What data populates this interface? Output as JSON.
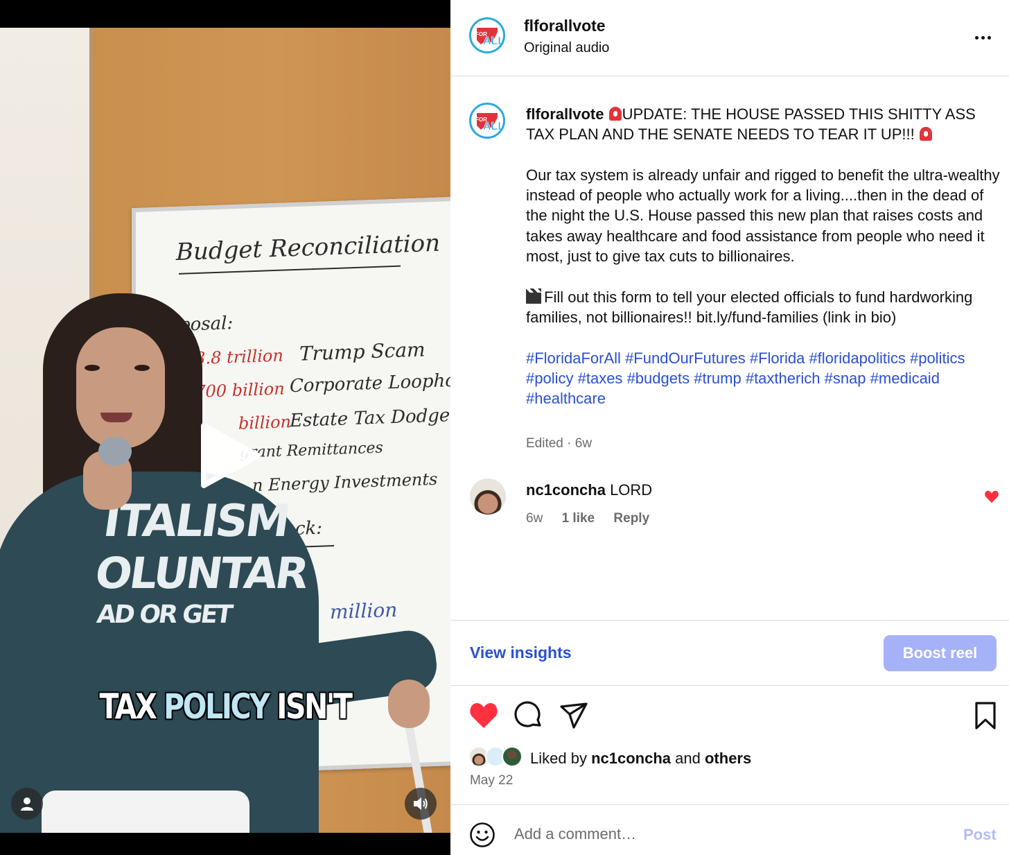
{
  "video": {
    "caption_words": [
      "TAX",
      "POLICY",
      "ISN'T"
    ],
    "whiteboard": {
      "title": "Budget Reconciliation",
      "proposal_label": "posal:",
      "items": [
        {
          "amount": "$3.8 trillion",
          "label": "Trump Scam"
        },
        {
          "amount": "$700 billion",
          "label": "Corporate Loophole"
        },
        {
          "amount": "billion",
          "label": "Estate Tax Dodge"
        },
        {
          "amount": "",
          "label": "grant Remittances"
        },
        {
          "amount": "",
          "label": "n Energy Investments"
        }
      ],
      "block_label": "lock:",
      "bottom_amount": "million"
    },
    "sweater_print": [
      "ITALISM",
      "OLUNTAR",
      "AD OR GET"
    ],
    "icons": {
      "play": "play-icon",
      "user": "user-icon",
      "volume": "volume-icon"
    }
  },
  "header": {
    "username": "flforallvote",
    "audio": "Original audio",
    "logo_text_top": "FOR",
    "logo_text_main": "ALL"
  },
  "caption": {
    "username": "flforallvote",
    "headline": "UPDATE: THE HOUSE PASSED THIS SHITTY ASS TAX PLAN AND THE SENATE NEEDS TO TEAR IT UP!!!",
    "paragraph_1": "Our tax system is already unfair and rigged to benefit the ultra-wealthy instead of people who actually work for a living....then in the dead of the night the U.S. House passed this new plan that raises costs and takes away healthcare and food assistance from people who need it most, just to give tax cuts to billionaires.",
    "paragraph_2": "Fill out this form to tell your elected officials to fund hardworking families, not billionaires!! bit.ly/fund-families (link in bio)",
    "hashtags": [
      "#FloridaForAll",
      "#FundOurFutures",
      "#Florida",
      "#floridapolitics",
      "#politics",
      "#policy",
      "#taxes",
      "#budgets",
      "#trump",
      "#taxtherich",
      "#snap",
      "#medicaid",
      "#healthcare"
    ],
    "edited_meta": "Edited · 6w"
  },
  "comment": {
    "username": "nc1concha",
    "text": "LORD",
    "age": "6w",
    "likes": "1 like",
    "reply": "Reply"
  },
  "insights": {
    "view_label": "View insights",
    "boost_label": "Boost reel"
  },
  "likes": {
    "prefix": "Liked by",
    "first_user": "nc1concha",
    "joiner": "and",
    "others": "others",
    "date": "May 22"
  },
  "comment_bar": {
    "placeholder": "Add a comment…",
    "post_label": "Post"
  },
  "colors": {
    "link_blue": "#2a4fd1",
    "boost_bg": "#a6b2f7",
    "like_red": "#ff3040",
    "logo_blue": "#29a9e1",
    "logo_red": "#e0343a"
  }
}
